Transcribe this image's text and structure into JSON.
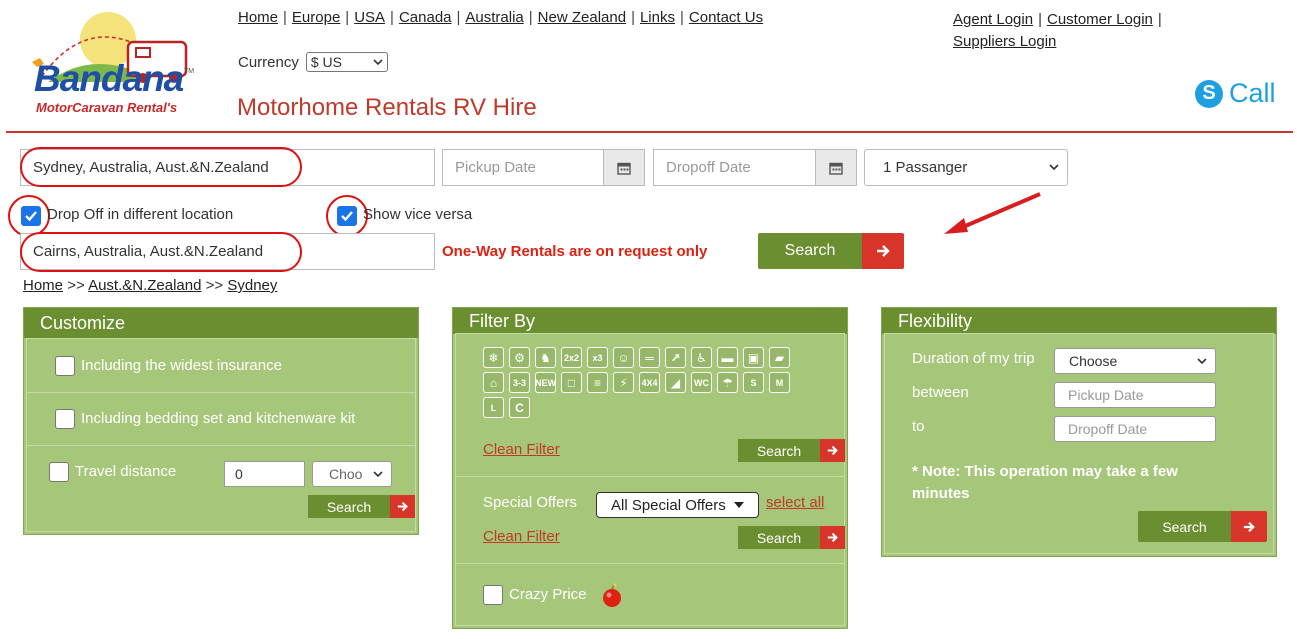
{
  "logo": {
    "brand": "Bandana",
    "subtitle": "MotorCaravan Rental's",
    "tm": "TM"
  },
  "nav": {
    "links": [
      "Home",
      "Europe",
      "USA",
      "Canada",
      "Australia",
      "New Zealand",
      "Links",
      "Contact Us"
    ],
    "separator": "|"
  },
  "login": {
    "agent": "Agent Login",
    "customer": "Customer Login",
    "suppliers": "Suppliers Login",
    "separator": "|"
  },
  "currency": {
    "label": "Currency",
    "value": "$ US"
  },
  "site_title": "Motorhome Rentals RV Hire",
  "call": {
    "label": "Call",
    "icon": "skype-icon"
  },
  "search": {
    "pickup_location": "Sydney, Australia, Aust.&N.Zealand",
    "pickup_date_placeholder": "Pickup Date",
    "dropoff_date_placeholder": "Dropoff Date",
    "passengers": "1 Passanger",
    "drop_off_different_label": "Drop Off in different location",
    "drop_off_different_checked": true,
    "vice_versa_label": "Show vice versa",
    "vice_versa_checked": true,
    "dropoff_location": "Cairns, Australia, Aust.&N.Zealand",
    "one_way_notice": "One-Way Rentals are on request only",
    "search_button": "Search"
  },
  "breadcrumb": {
    "items": [
      "Home",
      "Aust.&N.Zealand",
      "Sydney"
    ],
    "separator": ">>"
  },
  "customize": {
    "title": "Customize",
    "insurance_label": "Including the widest insurance",
    "bedding_label": "Including bedding set and kitchenware kit",
    "travel_distance_label": "Travel distance",
    "travel_distance_value": "0",
    "distance_unit": "Choo",
    "search_button": "Search"
  },
  "filter": {
    "title": "Filter By",
    "icons": [
      "ac",
      "gear",
      "seat",
      "2x2",
      "x3",
      "kids",
      "bed",
      "tv-ant",
      "wheelchair",
      "van",
      "camper",
      "truck",
      "tow",
      "3-3",
      "NEW",
      "tv",
      "bunk",
      "power",
      "4X4",
      "trailer",
      "WC",
      "shower",
      "S",
      "M",
      "L",
      "C"
    ],
    "icon_labels": {
      "2x2": "2x2",
      "x3": "x3",
      "3-3": "3-3",
      "NEW": "NEW",
      "4X4": "4X4",
      "WC": "WC",
      "S": "S",
      "M": "M",
      "L": "L"
    },
    "clean_filter": "Clean Filter",
    "search_button": "Search",
    "special_offers_label": "Special Offers",
    "special_offers_value": "All Special Offers",
    "select_all": "select all",
    "clean_filter_2": "Clean Filter",
    "search_button_2": "Search",
    "crazy_price_label": "Crazy Price"
  },
  "flexibility": {
    "title": "Flexibility",
    "duration_label": "Duration of my trip",
    "duration_value": "Choose",
    "between_label": "between",
    "pickup_placeholder": "Pickup Date",
    "to_label": "to",
    "dropoff_placeholder": "Dropoff Date",
    "note": "* Note: This operation may take a few minutes",
    "search_button": "Search"
  },
  "colors": {
    "panel": "#a6c67a",
    "panel_head": "#6b8e30",
    "accent_red": "#d7352a",
    "title_red": "#c0392b"
  }
}
